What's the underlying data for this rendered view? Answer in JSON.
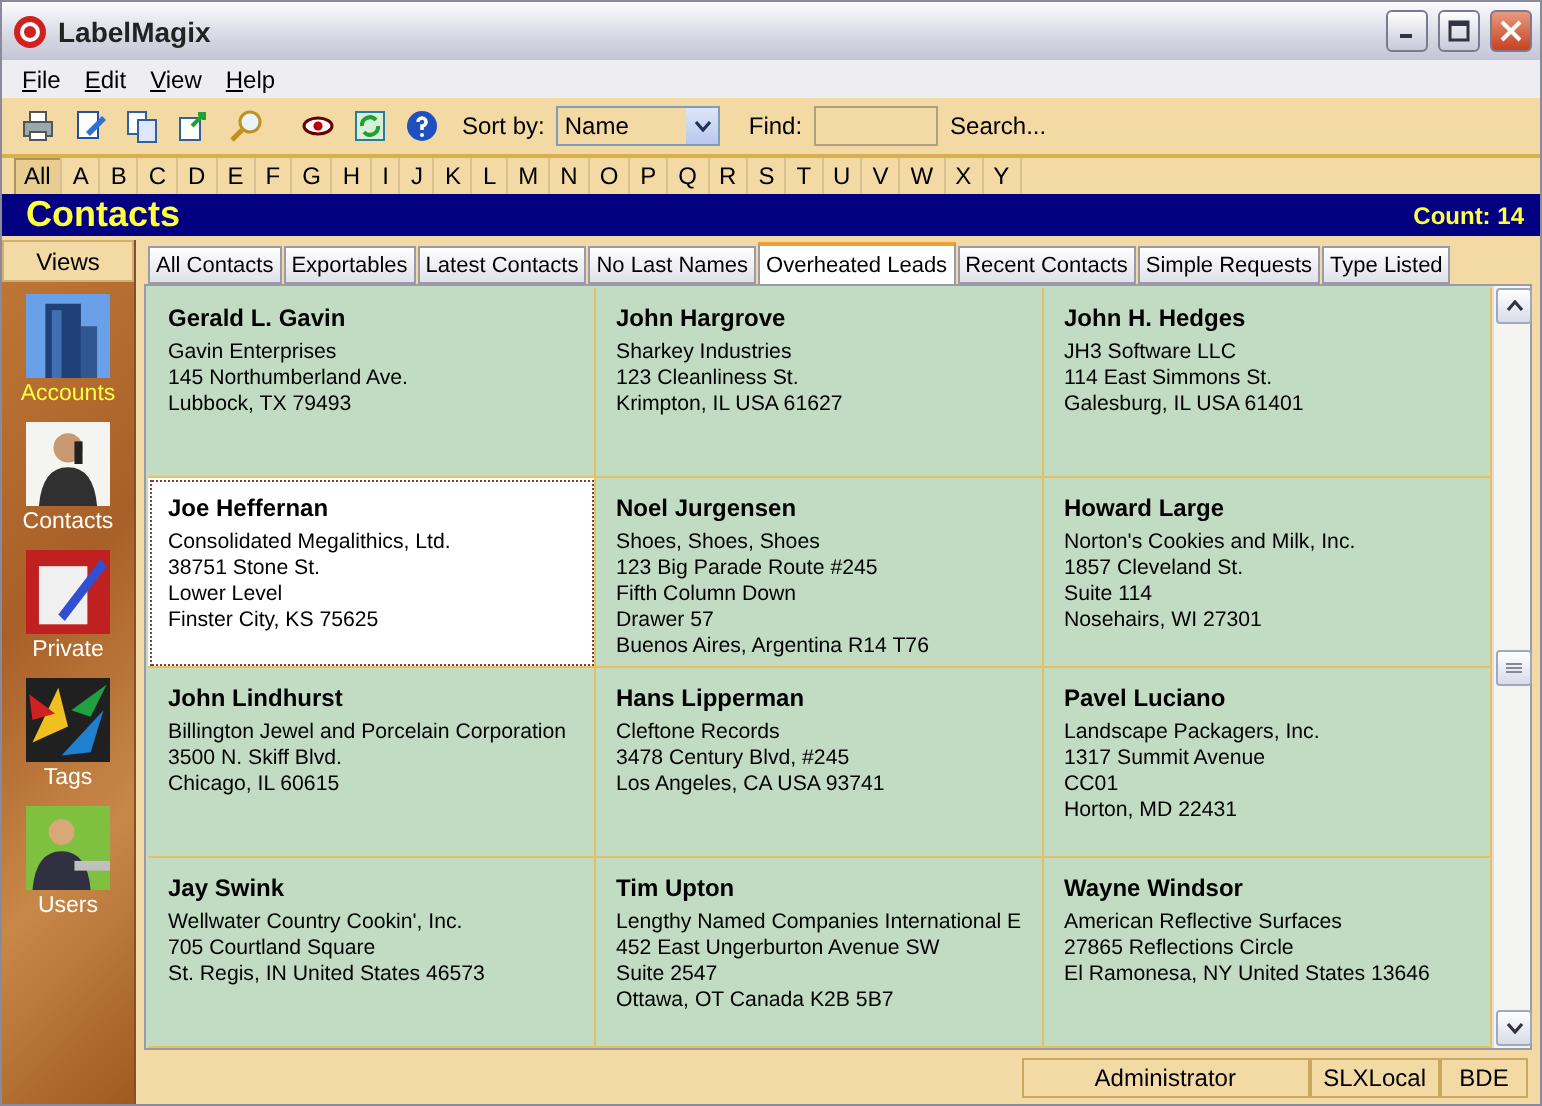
{
  "window": {
    "title": "LabelMagix"
  },
  "menu": [
    {
      "label": "File"
    },
    {
      "label": "Edit"
    },
    {
      "label": "View"
    },
    {
      "label": "Help"
    }
  ],
  "toolbar": {
    "sort_label": "Sort by:",
    "sort_value": "Name",
    "find_label": "Find:",
    "search_link": "Search..."
  },
  "letters": [
    {
      "label": "All",
      "selected": true
    },
    {
      "label": "A",
      "selected": false
    },
    {
      "label": "B",
      "selected": false
    },
    {
      "label": "C",
      "selected": false
    },
    {
      "label": "D",
      "selected": false
    },
    {
      "label": "E",
      "selected": false
    },
    {
      "label": "F",
      "selected": false
    },
    {
      "label": "G",
      "selected": false
    },
    {
      "label": "H",
      "selected": false
    },
    {
      "label": "I",
      "selected": false
    },
    {
      "label": "J",
      "selected": false
    },
    {
      "label": "K",
      "selected": false
    },
    {
      "label": "L",
      "selected": false
    },
    {
      "label": "M",
      "selected": false
    },
    {
      "label": "N",
      "selected": false
    },
    {
      "label": "O",
      "selected": false
    },
    {
      "label": "P",
      "selected": false
    },
    {
      "label": "Q",
      "selected": false
    },
    {
      "label": "R",
      "selected": false
    },
    {
      "label": "S",
      "selected": false
    },
    {
      "label": "T",
      "selected": false
    },
    {
      "label": "U",
      "selected": false
    },
    {
      "label": "V",
      "selected": false
    },
    {
      "label": "W",
      "selected": false
    },
    {
      "label": "X",
      "selected": false
    },
    {
      "label": "Y",
      "selected": false
    }
  ],
  "header": {
    "title": "Contacts",
    "count": "Count: 14"
  },
  "sidebar": {
    "heading": "Views",
    "items": [
      {
        "label": "Accounts",
        "selected": true
      },
      {
        "label": "Contacts",
        "selected": false
      },
      {
        "label": "Private",
        "selected": false
      },
      {
        "label": "Tags",
        "selected": false
      },
      {
        "label": "Users",
        "selected": false
      }
    ]
  },
  "tabs": [
    {
      "label": "All Contacts",
      "selected": false
    },
    {
      "label": "Exportables",
      "selected": false
    },
    {
      "label": "Latest Contacts",
      "selected": false
    },
    {
      "label": "No Last Names",
      "selected": false
    },
    {
      "label": "Overheated Leads",
      "selected": true
    },
    {
      "label": "Recent Contacts",
      "selected": false
    },
    {
      "label": "Simple Requests",
      "selected": false
    },
    {
      "label": "Type Listed",
      "selected": false
    }
  ],
  "contacts": [
    {
      "name": "Gerald L. Gavin",
      "lines": [
        "Gavin Enterprises",
        "145 Northumberland Ave.",
        "Lubbock, TX  79493"
      ],
      "selected": false
    },
    {
      "name": "John Hargrove",
      "lines": [
        "Sharkey Industries",
        "123 Cleanliness St.",
        "Krimpton, IL USA 61627"
      ],
      "selected": false
    },
    {
      "name": "John H. Hedges",
      "lines": [
        "JH3 Software LLC",
        "114 East Simmons St.",
        "Galesburg, IL USA 61401"
      ],
      "selected": false
    },
    {
      "name": "Joe Heffernan",
      "lines": [
        "Consolidated Megalithics, Ltd.",
        "38751 Stone St.",
        "Lower Level",
        "Finster City, KS  75625"
      ],
      "selected": true
    },
    {
      "name": "Noel Jurgensen",
      "lines": [
        "Shoes, Shoes, Shoes",
        "123 Big Parade Route #245",
        "Fifth Column Down",
        "Drawer 57",
        "Buenos Aires,  Argentina R14 T76"
      ],
      "selected": false
    },
    {
      "name": "Howard Large",
      "lines": [
        "Norton's Cookies and Milk, Inc.",
        "1857 Cleveland St.",
        "Suite 114",
        "Nosehairs, WI  27301"
      ],
      "selected": false
    },
    {
      "name": "John Lindhurst",
      "lines": [
        "Billington Jewel and Porcelain Corporation",
        "3500 N. Skiff Blvd.",
        "Chicago, IL  60615"
      ],
      "selected": false
    },
    {
      "name": "Hans Lipperman",
      "lines": [
        "Cleftone Records",
        "3478 Century Blvd, #245",
        "Los Angeles, CA USA 93741"
      ],
      "selected": false
    },
    {
      "name": "Pavel Luciano",
      "lines": [
        "Landscape Packagers, Inc.",
        "1317 Summit Avenue",
        "CC01",
        "Horton, MD  22431"
      ],
      "selected": false
    },
    {
      "name": "Jay Swink",
      "lines": [
        "Wellwater Country Cookin', Inc.",
        "705 Courtland Square",
        "St. Regis, IN United States 46573"
      ],
      "selected": false
    },
    {
      "name": "Tim Upton",
      "lines": [
        "Lengthy Named Companies International E",
        "452 East Ungerburton Avenue SW",
        "Suite 2547",
        "Ottawa, OT Canada K2B 5B7"
      ],
      "selected": false
    },
    {
      "name": "Wayne Windsor",
      "lines": [
        "American Reflective Surfaces",
        "27865 Reflections Circle",
        "El Ramonesa, NY United States 13646"
      ],
      "selected": false
    }
  ],
  "status_bar": [
    "Administrator",
    "SLXLocal",
    "BDE"
  ]
}
